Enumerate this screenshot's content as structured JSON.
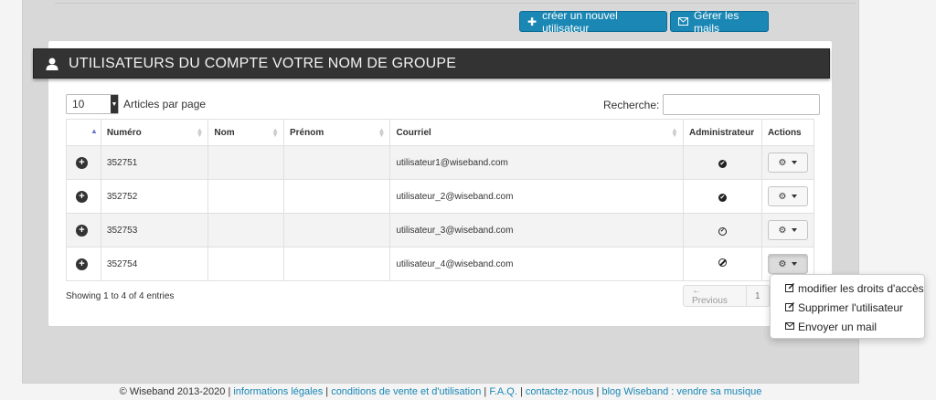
{
  "toolbar": {
    "create_label": "créer un nouvel utilisateur",
    "mails_label": "Gérer les mails"
  },
  "panel": {
    "title": "UTILISATEURS DU COMPTE VOTRE NOM DE GROUPE"
  },
  "table_controls": {
    "length_value": "10",
    "length_label": "Articles par page",
    "search_label": "Recherche:",
    "search_value": "",
    "search_placeholder": ""
  },
  "table": {
    "headers": [
      "",
      "Numéro",
      "Nom",
      "Prénom",
      "Courriel",
      "Administrateur",
      "Actions"
    ],
    "rows": [
      {
        "numero": "352751",
        "nom": "",
        "prenom": "",
        "courriel": "utilisateur1@wiseband.com",
        "admin": "yes"
      },
      {
        "numero": "352752",
        "nom": "",
        "prenom": "",
        "courriel": "utilisateur_2@wiseband.com",
        "admin": "yes"
      },
      {
        "numero": "352753",
        "nom": "",
        "prenom": "",
        "courriel": "utilisateur_3@wiseband.com",
        "admin": "pending"
      },
      {
        "numero": "352754",
        "nom": "",
        "prenom": "",
        "courriel": "utilisateur_4@wiseband.com",
        "admin": "no"
      }
    ]
  },
  "table_info": "Showing 1 to 4 of 4 entries",
  "pagination": {
    "prev_label": "← Previous",
    "page": "1"
  },
  "actions_menu": {
    "items": [
      "modifier les droits d'accès",
      "Supprimer l'utilisateur",
      "Envoyer un mail"
    ]
  },
  "footer": {
    "copyright": "© Wiseband 2013-2020",
    "links": [
      "informations légales",
      "conditions de vente et d'utilisation",
      "F.A.Q.",
      "contactez-nous",
      "blog Wiseband : vendre sa musique"
    ]
  },
  "colors": {
    "primary": "#1a87b4",
    "header_bg": "#333333"
  }
}
